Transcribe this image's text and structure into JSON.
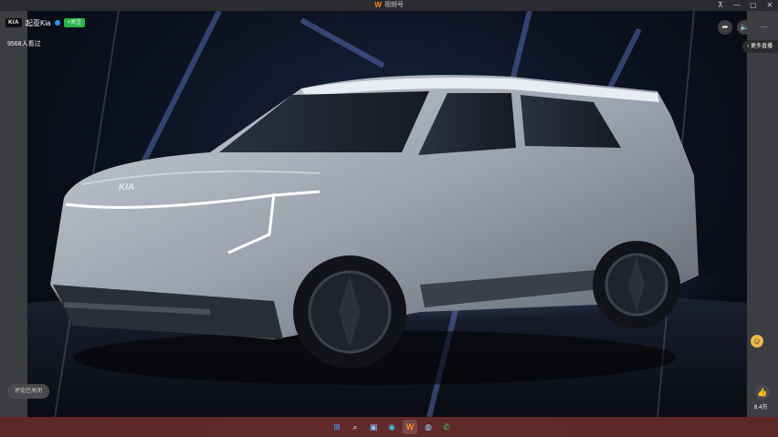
{
  "window": {
    "title": "视频号",
    "controls": {
      "pin": "⊼",
      "minimize": "—",
      "maximize": "▢",
      "close": "✕"
    }
  },
  "channel": {
    "logo_text": "KIA",
    "name": "起亚Kia",
    "follow_label": "+关注"
  },
  "stats": {
    "viewers": "9568人看过",
    "likes": "6.4万"
  },
  "controls": {
    "more_live": "更多直播",
    "comment_off": "评论已关闭"
  },
  "colors": {
    "follow_green": "#2bb24c",
    "brand_orange": "#ff8a1f",
    "taskbar": "#5c2727"
  },
  "icons": {
    "share": "share-icon",
    "volume": "volume-icon",
    "more": "more-icon",
    "like": "thumb-up-icon",
    "emoji": "emoji-icon"
  }
}
